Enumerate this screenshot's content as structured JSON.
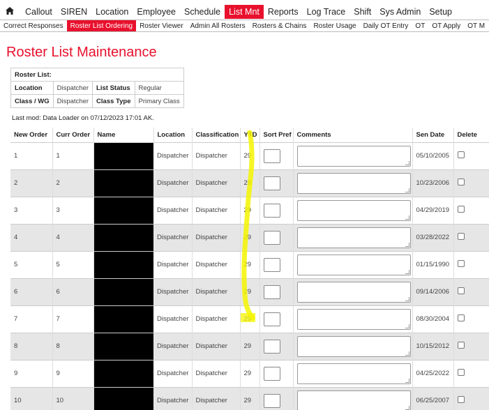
{
  "top_nav": {
    "home_icon": "home-icon",
    "items": [
      {
        "label": "Callout",
        "active": false
      },
      {
        "label": "SIREN",
        "active": false
      },
      {
        "label": "Location",
        "active": false
      },
      {
        "label": "Employee",
        "active": false
      },
      {
        "label": "Schedule",
        "active": false
      },
      {
        "label": "List Mnt",
        "active": true
      },
      {
        "label": "Reports",
        "active": false
      },
      {
        "label": "Log Trace",
        "active": false
      },
      {
        "label": "Shift",
        "active": false
      },
      {
        "label": "Sys Admin",
        "active": false
      },
      {
        "label": "Setup",
        "active": false
      }
    ]
  },
  "sub_nav": {
    "items": [
      {
        "label": "Correct Responses",
        "active": false
      },
      {
        "label": "Roster List Ordering",
        "active": true
      },
      {
        "label": "Roster Viewer",
        "active": false
      },
      {
        "label": "Admin All Rosters",
        "active": false
      },
      {
        "label": "Rosters & Chains",
        "active": false
      },
      {
        "label": "Roster Usage",
        "active": false
      },
      {
        "label": "Daily OT Entry",
        "active": false
      },
      {
        "label": "OT",
        "active": false
      },
      {
        "label": "OT Apply",
        "active": false
      },
      {
        "label": "OT M",
        "active": false
      }
    ]
  },
  "page": {
    "title": "Roster List Maintenance"
  },
  "roster_info": {
    "header": "Roster List:",
    "location_label": "Location",
    "location_value": "Dispatcher",
    "list_status_label": "List Status",
    "list_status_value": "Regular",
    "class_wg_label": "Class / WG",
    "class_wg_value": "Dispatcher",
    "class_type_label": "Class Type",
    "class_type_value": "Primary Class"
  },
  "last_mod": "Last mod: Data Loader on 07/12/2023 17:01 AK.",
  "grid": {
    "columns": [
      "New Order",
      "Curr Order",
      "Name",
      "Location",
      "Classification",
      "YTD",
      "Sort Pref",
      "Comments",
      "Sen Date",
      "Delete"
    ],
    "rows": [
      {
        "new_order": "1",
        "curr_order": "1",
        "location": "Dispatcher",
        "classification": "Dispatcher",
        "ytd": "29",
        "sen_date": "05/10/2005"
      },
      {
        "new_order": "2",
        "curr_order": "2",
        "location": "Dispatcher",
        "classification": "Dispatcher",
        "ytd": "29",
        "sen_date": "10/23/2006"
      },
      {
        "new_order": "3",
        "curr_order": "3",
        "location": "Dispatcher",
        "classification": "Dispatcher",
        "ytd": "29",
        "sen_date": "04/29/2019"
      },
      {
        "new_order": "4",
        "curr_order": "4",
        "location": "Dispatcher",
        "classification": "Dispatcher",
        "ytd": "29",
        "sen_date": "03/28/2022"
      },
      {
        "new_order": "5",
        "curr_order": "5",
        "location": "Dispatcher",
        "classification": "Dispatcher",
        "ytd": "29",
        "sen_date": "01/15/1990"
      },
      {
        "new_order": "6",
        "curr_order": "6",
        "location": "Dispatcher",
        "classification": "Dispatcher",
        "ytd": "29",
        "sen_date": "09/14/2006"
      },
      {
        "new_order": "7",
        "curr_order": "7",
        "location": "Dispatcher",
        "classification": "Dispatcher",
        "ytd": "29",
        "sen_date": "08/30/2004"
      },
      {
        "new_order": "8",
        "curr_order": "8",
        "location": "Dispatcher",
        "classification": "Dispatcher",
        "ytd": "29",
        "sen_date": "10/15/2012"
      },
      {
        "new_order": "9",
        "curr_order": "9",
        "location": "Dispatcher",
        "classification": "Dispatcher",
        "ytd": "29",
        "sen_date": "04/25/2022"
      },
      {
        "new_order": "10",
        "curr_order": "10",
        "location": "Dispatcher",
        "classification": "Dispatcher",
        "ytd": "29",
        "sen_date": "06/25/2007"
      }
    ]
  },
  "colors": {
    "accent": "#e8112d",
    "highlight": "#f4f400",
    "row_alt": "#e6e6e6"
  }
}
